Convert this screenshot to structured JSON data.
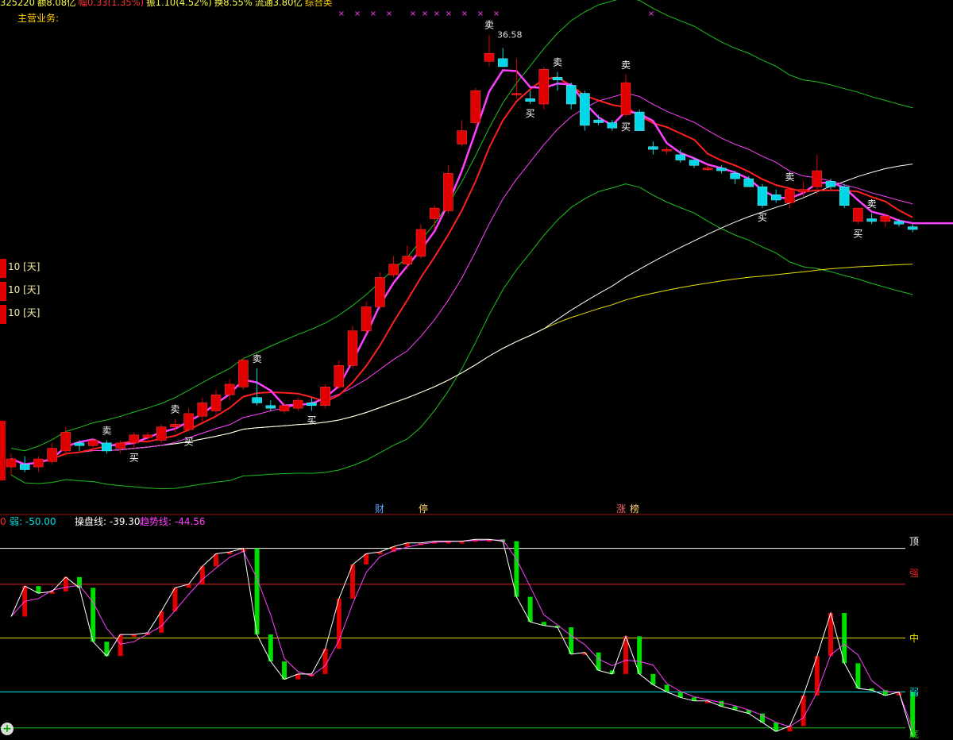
{
  "header": {
    "code_fragment": "325220",
    "amount": "额8.08亿",
    "change": "幅0.33(1.35%)",
    "amplitude": "振1.10(4.52%)",
    "turnover": "换8.55%",
    "float": "流通3.80亿",
    "rating": "综合类"
  },
  "main_business_label": "主营业务:",
  "peak_price_label": "36.58",
  "side_labels": [
    "10 [天]",
    "10 [天]",
    "10 [天]"
  ],
  "event_markers": [
    {
      "text": "财",
      "color": "#5aa8ff"
    },
    {
      "text": "停",
      "color": "#ffd36b"
    },
    {
      "text": "涨",
      "color": "#ff6b6b"
    },
    {
      "text": "榜",
      "color": "#ffd36b"
    }
  ],
  "indicator": {
    "ruo_prefix": "0",
    "ruo_value": "弱: -50.00",
    "operation_line": "操盘线: -39.30",
    "trend_line": "趋势线: -44.56",
    "levels": [
      {
        "label": "顶",
        "value": 100,
        "color": "#ffffff"
      },
      {
        "label": "强",
        "value": 80,
        "color": "#e02020"
      },
      {
        "label": "中",
        "value": 50,
        "color": "#e8e000"
      },
      {
        "label": "弱",
        "value": 20,
        "color": "#00e0e0"
      },
      {
        "label": "底",
        "value": 0,
        "color": "#20c020"
      }
    ]
  },
  "colors": {
    "up": "#e00000",
    "down": "#00d8e8",
    "fast_ma": "#ff40ff",
    "ma2": "#ff2020",
    "ma3": "#ff40ff",
    "ma4": "#ffffff",
    "ma5": "#e8e000",
    "band": "#20c020"
  },
  "chart_data": {
    "type": "candlestick",
    "title": "",
    "peak_label": "36.58",
    "ylim_main": [
      19.5,
      37.5
    ],
    "ylim_indicator": [
      -5,
      110
    ],
    "candles": [
      {
        "o": 20.3,
        "h": 20.8,
        "l": 20.0,
        "c": 20.6
      },
      {
        "o": 20.4,
        "h": 20.7,
        "l": 20.1,
        "c": 20.2
      },
      {
        "o": 20.3,
        "h": 20.7,
        "l": 20.1,
        "c": 20.6
      },
      {
        "o": 20.5,
        "h": 21.2,
        "l": 20.4,
        "c": 21.0
      },
      {
        "o": 20.9,
        "h": 21.8,
        "l": 20.7,
        "c": 21.6
      },
      {
        "o": 21.2,
        "h": 21.3,
        "l": 20.9,
        "c": 21.1
      },
      {
        "o": 21.1,
        "h": 21.4,
        "l": 20.9,
        "c": 21.3
      },
      {
        "o": 21.2,
        "h": 21.3,
        "l": 20.8,
        "c": 20.9
      },
      {
        "o": 21.0,
        "h": 21.3,
        "l": 20.8,
        "c": 21.2
      },
      {
        "o": 21.2,
        "h": 21.6,
        "l": 21.0,
        "c": 21.5
      },
      {
        "o": 21.4,
        "h": 21.6,
        "l": 21.2,
        "c": 21.5
      },
      {
        "o": 21.3,
        "h": 21.9,
        "l": 21.2,
        "c": 21.8
      },
      {
        "o": 21.8,
        "h": 22.1,
        "l": 21.6,
        "c": 21.9
      },
      {
        "o": 21.7,
        "h": 22.5,
        "l": 21.6,
        "c": 22.3
      },
      {
        "o": 22.2,
        "h": 22.9,
        "l": 22.0,
        "c": 22.7
      },
      {
        "o": 22.4,
        "h": 23.2,
        "l": 22.2,
        "c": 23.0
      },
      {
        "o": 23.0,
        "h": 23.6,
        "l": 22.8,
        "c": 23.4
      },
      {
        "o": 23.3,
        "h": 24.4,
        "l": 23.2,
        "c": 24.3
      },
      {
        "o": 22.9,
        "h": 24.0,
        "l": 22.6,
        "c": 22.7
      },
      {
        "o": 22.6,
        "h": 22.8,
        "l": 22.4,
        "c": 22.5
      },
      {
        "o": 22.4,
        "h": 22.7,
        "l": 22.3,
        "c": 22.6
      },
      {
        "o": 22.5,
        "h": 22.9,
        "l": 22.4,
        "c": 22.8
      },
      {
        "o": 22.7,
        "h": 22.9,
        "l": 22.4,
        "c": 22.6
      },
      {
        "o": 22.6,
        "h": 23.4,
        "l": 22.5,
        "c": 23.3
      },
      {
        "o": 23.3,
        "h": 24.3,
        "l": 23.2,
        "c": 24.1
      },
      {
        "o": 24.1,
        "h": 25.6,
        "l": 24.0,
        "c": 25.4
      },
      {
        "o": 25.4,
        "h": 26.5,
        "l": 25.3,
        "c": 26.3
      },
      {
        "o": 26.3,
        "h": 27.6,
        "l": 26.2,
        "c": 27.4
      },
      {
        "o": 27.5,
        "h": 28.2,
        "l": 27.4,
        "c": 27.9
      },
      {
        "o": 27.9,
        "h": 28.6,
        "l": 27.7,
        "c": 28.2
      },
      {
        "o": 28.2,
        "h": 29.4,
        "l": 28.1,
        "c": 29.2
      },
      {
        "o": 29.6,
        "h": 30.1,
        "l": 29.2,
        "c": 30.0
      },
      {
        "o": 29.9,
        "h": 31.6,
        "l": 29.8,
        "c": 31.3
      },
      {
        "o": 32.4,
        "h": 33.3,
        "l": 32.3,
        "c": 32.9
      },
      {
        "o": 33.2,
        "h": 34.5,
        "l": 33.1,
        "c": 34.4
      },
      {
        "o": 35.5,
        "h": 36.5,
        "l": 35.3,
        "c": 35.8
      },
      {
        "o": 35.6,
        "h": 36.0,
        "l": 35.3,
        "c": 35.3
      },
      {
        "o": 34.3,
        "h": 35.6,
        "l": 34.1,
        "c": 34.3
      },
      {
        "o": 34.1,
        "h": 34.4,
        "l": 33.9,
        "c": 34.0
      },
      {
        "o": 33.9,
        "h": 35.3,
        "l": 33.7,
        "c": 35.2
      },
      {
        "o": 34.9,
        "h": 35.1,
        "l": 34.4,
        "c": 34.8
      },
      {
        "o": 34.6,
        "h": 34.7,
        "l": 33.7,
        "c": 33.9
      },
      {
        "o": 34.3,
        "h": 34.4,
        "l": 32.9,
        "c": 33.1
      },
      {
        "o": 33.3,
        "h": 33.5,
        "l": 33.1,
        "c": 33.2
      },
      {
        "o": 33.2,
        "h": 33.3,
        "l": 32.9,
        "c": 33.0
      },
      {
        "o": 33.5,
        "h": 35.0,
        "l": 33.4,
        "c": 34.7
      },
      {
        "o": 33.6,
        "h": 33.7,
        "l": 32.9,
        "c": 32.9
      },
      {
        "o": 32.3,
        "h": 32.5,
        "l": 32.0,
        "c": 32.2
      },
      {
        "o": 32.2,
        "h": 32.3,
        "l": 32.0,
        "c": 32.2
      },
      {
        "o": 32.0,
        "h": 32.2,
        "l": 31.7,
        "c": 31.8
      },
      {
        "o": 31.8,
        "h": 31.9,
        "l": 31.5,
        "c": 31.6
      },
      {
        "o": 31.5,
        "h": 31.6,
        "l": 31.4,
        "c": 31.5
      },
      {
        "o": 31.5,
        "h": 31.6,
        "l": 31.3,
        "c": 31.4
      },
      {
        "o": 31.3,
        "h": 31.4,
        "l": 30.9,
        "c": 31.1
      },
      {
        "o": 31.1,
        "h": 31.2,
        "l": 30.8,
        "c": 30.8
      },
      {
        "o": 30.8,
        "h": 30.9,
        "l": 30.0,
        "c": 30.1
      },
      {
        "o": 30.5,
        "h": 30.7,
        "l": 30.2,
        "c": 30.3
      },
      {
        "o": 30.2,
        "h": 30.8,
        "l": 30.0,
        "c": 30.7
      },
      {
        "o": 30.6,
        "h": 31.0,
        "l": 30.4,
        "c": 30.7
      },
      {
        "o": 30.8,
        "h": 32.0,
        "l": 30.5,
        "c": 31.4
      },
      {
        "o": 31.0,
        "h": 31.1,
        "l": 30.7,
        "c": 30.8
      },
      {
        "o": 30.8,
        "h": 30.9,
        "l": 30.0,
        "c": 30.1
      },
      {
        "o": 29.5,
        "h": 30.0,
        "l": 29.4,
        "c": 30.0
      },
      {
        "o": 29.6,
        "h": 29.8,
        "l": 29.4,
        "c": 29.5
      },
      {
        "o": 29.5,
        "h": 29.8,
        "l": 29.3,
        "c": 29.7
      },
      {
        "o": 29.5,
        "h": 29.6,
        "l": 29.3,
        "c": 29.4
      },
      {
        "o": 29.3,
        "h": 29.4,
        "l": 29.1,
        "c": 29.2
      }
    ],
    "signals": [
      {
        "text": "卖",
        "index": 7
      },
      {
        "text": "买",
        "index": 9
      },
      {
        "text": "卖",
        "index": 12
      },
      {
        "text": "买",
        "index": 13
      },
      {
        "text": "卖",
        "index": 18
      },
      {
        "text": "买",
        "index": 22
      },
      {
        "text": "卖",
        "index": 35
      },
      {
        "text": "买",
        "index": 38
      },
      {
        "text": "卖",
        "index": 40
      },
      {
        "text": "卖",
        "index": 45
      },
      {
        "text": "买",
        "index": 45
      },
      {
        "text": "卖",
        "index": 57
      },
      {
        "text": "买",
        "index": 55
      },
      {
        "text": "卖",
        "index": 63
      },
      {
        "text": "买",
        "index": 62
      }
    ],
    "indicator_series": {
      "operation_line": [
        62,
        79,
        75,
        76,
        84,
        78,
        48,
        40,
        52,
        52,
        53,
        65,
        78,
        80,
        90,
        97,
        98,
        100,
        52,
        37,
        27,
        30,
        30,
        44,
        72,
        91,
        97,
        98,
        101,
        103,
        103,
        104,
        104,
        104,
        105,
        105,
        104,
        73,
        59,
        57,
        56,
        41,
        42,
        32,
        30,
        51,
        30,
        24,
        20,
        17,
        15,
        15,
        12,
        10,
        8,
        3,
        -2,
        1,
        18,
        40,
        64,
        36,
        22,
        21,
        18,
        20,
        -39
      ]
    }
  }
}
